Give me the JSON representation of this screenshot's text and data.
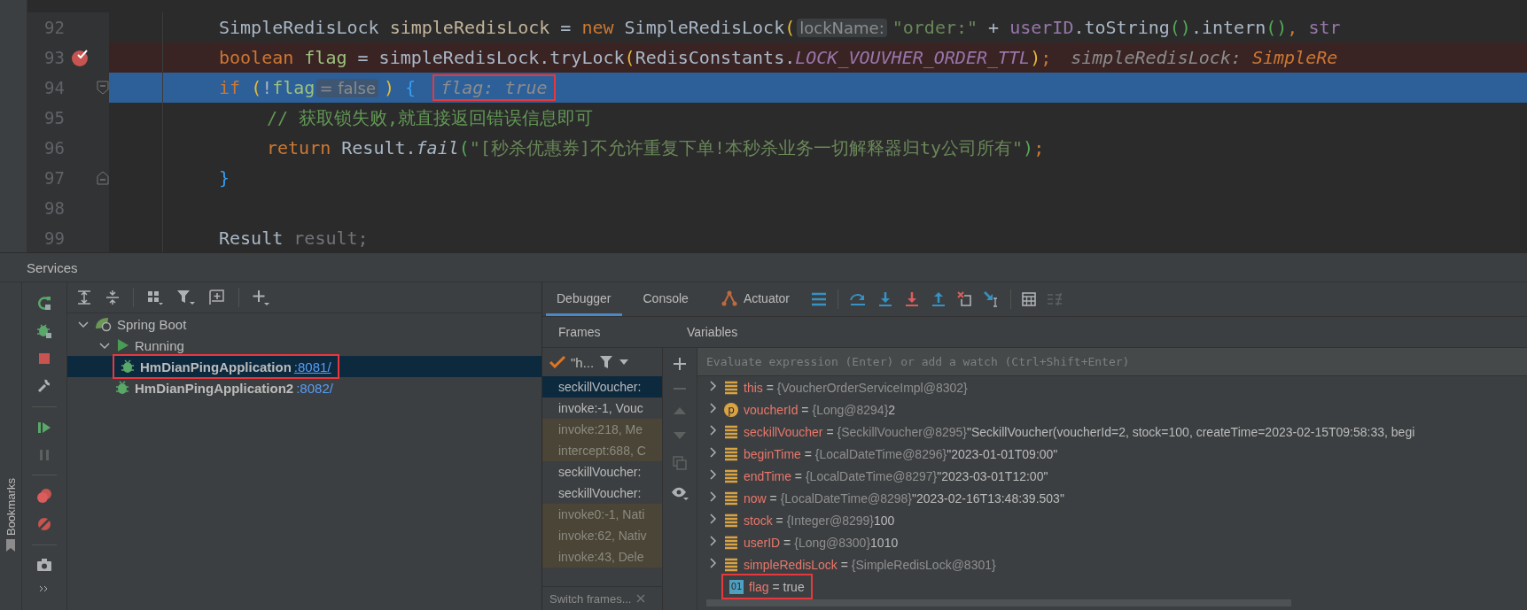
{
  "editor": {
    "lines": [
      {
        "number": "92",
        "current": false,
        "breakpoint": false,
        "tokens": [
          {
            "kind": "plain",
            "text": "SimpleRedisLock "
          },
          {
            "kind": "local",
            "text": "simpleRedisLock"
          },
          {
            "kind": "plain",
            "text": " = "
          },
          {
            "kind": "kw",
            "text": "new"
          },
          {
            "kind": "plain",
            "text": " SimpleRedisLock"
          },
          {
            "kind": "paren",
            "text": "("
          },
          {
            "kind": "inlay",
            "text": "lockName:"
          },
          {
            "kind": "str",
            "text": "\"order:\""
          },
          {
            "kind": "plain",
            "text": " + "
          },
          {
            "kind": "field",
            "text": "userID"
          },
          {
            "kind": "plain",
            "text": ".toString"
          },
          {
            "kind": "paren2",
            "text": "()"
          },
          {
            "kind": "plain",
            "text": ".intern"
          },
          {
            "kind": "paren2",
            "text": "()"
          },
          {
            "kind": "kw",
            "text": ", "
          },
          {
            "kind": "field",
            "text": "str"
          }
        ]
      },
      {
        "number": "93",
        "current": false,
        "breakpoint": true,
        "tokens": [
          {
            "kind": "kw",
            "text": "boolean "
          },
          {
            "kind": "var",
            "text": "flag"
          },
          {
            "kind": "plain",
            "text": " = simpleRedisLock.tryLock"
          },
          {
            "kind": "paren",
            "text": "("
          },
          {
            "kind": "plain",
            "text": "RedisConstants."
          },
          {
            "kind": "const",
            "text": "LOCK_VOUVHER_ORDER_TTL"
          },
          {
            "kind": "paren",
            "text": ")"
          },
          {
            "kind": "kw",
            "text": ";"
          },
          {
            "kind": "debug",
            "text": "simpleRedisLock: "
          },
          {
            "kind": "debugtype",
            "text": "SimpleRe"
          }
        ]
      },
      {
        "number": "94",
        "kind": "block_start",
        "current": true,
        "breakpoint": false,
        "tokens": [
          {
            "kind": "kw",
            "text": "if "
          },
          {
            "kind": "paren",
            "text": "("
          },
          {
            "kind": "plain",
            "text": "!"
          },
          {
            "kind": "var",
            "text": "flag"
          },
          {
            "kind": "inlay",
            "text": "= false"
          },
          {
            "kind": "paren",
            "text": ") "
          },
          {
            "kind": "brace",
            "text": "{"
          },
          {
            "kind": "debug",
            "text": "flag: true",
            "outlined": true
          }
        ],
        "children": [
          {
            "number": "95",
            "current": false,
            "breakpoint": false,
            "tokens": [
              {
                "kind": "comment",
                "text": "// 获取锁失败,就直接返回错误信息即可"
              }
            ]
          },
          {
            "number": "96",
            "current": false,
            "breakpoint": false,
            "tokens": [
              {
                "kind": "kw",
                "text": "return"
              },
              {
                "kind": "plain",
                "text": " Result."
              },
              {
                "kind": "italic",
                "text": "fail"
              },
              {
                "kind": "paren2",
                "text": "("
              },
              {
                "kind": "str",
                "text": "\"[秒杀优惠券]不允许重复下单!本秒杀业务一切解释器归ty公司所有\""
              },
              {
                "kind": "paren2",
                "text": ")"
              },
              {
                "kind": "kw",
                "text": ";"
              }
            ]
          }
        ]
      },
      {
        "number": "97",
        "kind": "block_end",
        "current": false,
        "breakpoint": false,
        "tokens": [
          {
            "kind": "brace",
            "text": "}"
          }
        ]
      },
      {
        "number": "98",
        "current": false,
        "breakpoint": false
      },
      {
        "number": "99",
        "current": false,
        "breakpoint": false,
        "tokens": [
          {
            "kind": "plain",
            "text": "Result "
          },
          {
            "kind": "unused",
            "text": "result;"
          }
        ]
      }
    ]
  },
  "services": {
    "title": "Services",
    "side_tab": "Bookmarks",
    "tree": [
      {
        "label": "Spring Boot",
        "kind": "spring",
        "expanded": true,
        "children": [
          {
            "label": "Running",
            "kind": "running",
            "expanded": true,
            "children": [
              {
                "label": "HmDianPingApplication",
                "port": ":8081/",
                "kind": "debug_app",
                "selected": true,
                "outlined": true
              },
              {
                "label": "HmDianPingApplication2",
                "port": ":8082/",
                "kind": "debug_app",
                "selected": false,
                "outlined": false
              }
            ]
          }
        ]
      }
    ]
  },
  "debugger": {
    "tabs": [
      {
        "label": "Debugger",
        "kind": "plain",
        "selected": true
      },
      {
        "label": "Console",
        "kind": "plain",
        "selected": false
      },
      {
        "label": "Actuator",
        "kind": "actuator",
        "selected": false
      }
    ],
    "frames": {
      "header": "Frames",
      "thread": "\"h...",
      "footer": "Switch frames...",
      "items": [
        {
          "label": "seckillVoucher:",
          "selected": true,
          "library": false
        },
        {
          "label": "invoke:-1, Vouc",
          "selected": false,
          "library": false
        },
        {
          "label": "invoke:218, Me",
          "selected": false,
          "library": true
        },
        {
          "label": "intercept:688, C",
          "selected": false,
          "library": true
        },
        {
          "label": "seckillVoucher:",
          "selected": false,
          "library": false
        },
        {
          "label": "seckillVoucher:",
          "selected": false,
          "library": false
        },
        {
          "label": "invoke0:-1, Nati",
          "selected": false,
          "library": true
        },
        {
          "label": "invoke:62, Nativ",
          "selected": false,
          "library": true
        },
        {
          "label": "invoke:43, Dele",
          "selected": false,
          "library": true
        }
      ]
    },
    "variables": {
      "header": "Variables",
      "placeholder": "Evaluate expression (Enter) or add a watch (Ctrl+Shift+Enter)",
      "items": [
        {
          "kind": "object",
          "expandable": true,
          "outlined": false,
          "name": "this",
          "operator": "=",
          "type": "{VoucherOrderServiceImpl@8302}"
        },
        {
          "kind": "param",
          "badge": "p",
          "expandable": true,
          "outlined": false,
          "name": "voucherId",
          "operator": "=",
          "type": "{Long@8294}",
          "value": "2"
        },
        {
          "kind": "object",
          "expandable": true,
          "outlined": false,
          "name": "seckillVoucher",
          "operator": "=",
          "type": "{SeckillVoucher@8295}",
          "value": "\"SeckillVoucher(voucherId=2, stock=100, createTime=2023-02-15T09:58:33, begi"
        },
        {
          "kind": "object",
          "expandable": true,
          "outlined": false,
          "name": "beginTime",
          "operator": "=",
          "type": "{LocalDateTime@8296}",
          "value": "\"2023-01-01T09:00\""
        },
        {
          "kind": "object",
          "expandable": true,
          "outlined": false,
          "name": "endTime",
          "operator": "=",
          "type": "{LocalDateTime@8297}",
          "value": "\"2023-03-01T12:00\""
        },
        {
          "kind": "object",
          "expandable": true,
          "outlined": false,
          "name": "now",
          "operator": "=",
          "type": "{LocalDateTime@8298}",
          "value": "\"2023-02-16T13:48:39.503\""
        },
        {
          "kind": "object",
          "expandable": true,
          "outlined": false,
          "name": "stock",
          "operator": "=",
          "type": "{Integer@8299}",
          "value": "100"
        },
        {
          "kind": "object",
          "expandable": true,
          "outlined": false,
          "name": "userID",
          "operator": "=",
          "type": "{Long@8300}",
          "value": "1010"
        },
        {
          "kind": "object",
          "expandable": true,
          "outlined": false,
          "name": "simpleRedisLock",
          "operator": "=",
          "type": "{SimpleRedisLock@8301}"
        },
        {
          "kind": "primitive",
          "badge": "01",
          "expandable": false,
          "outlined": true,
          "name": "flag",
          "operator": "=",
          "value": "true"
        }
      ]
    }
  }
}
